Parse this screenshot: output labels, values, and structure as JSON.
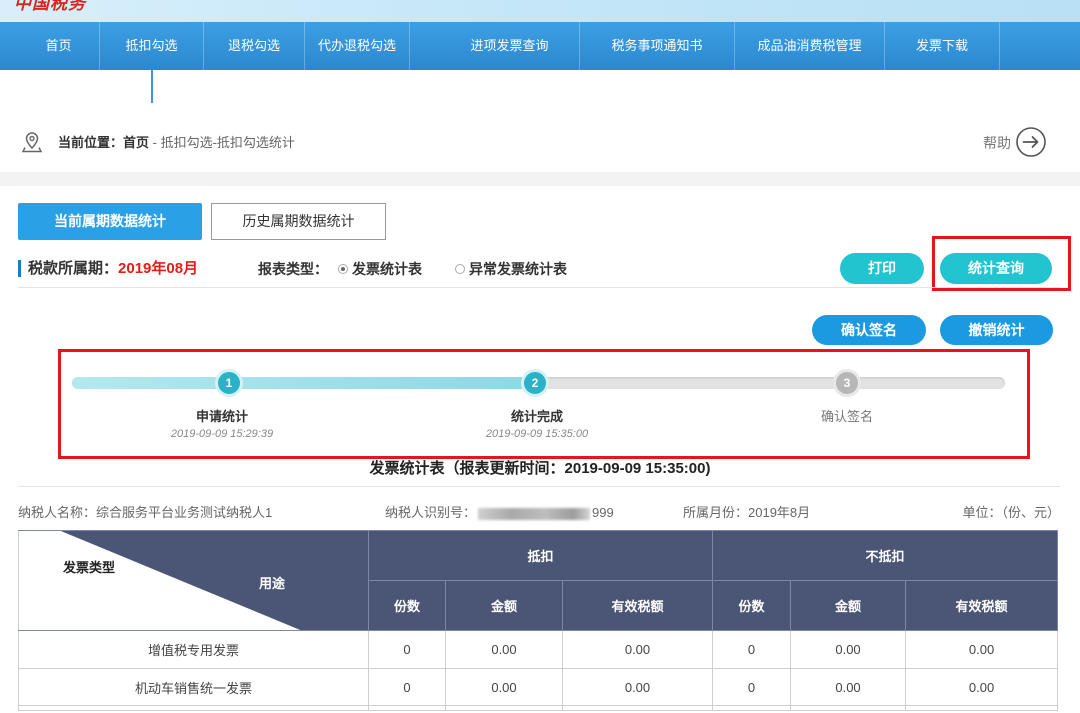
{
  "header": {
    "logo_text": "中国税务"
  },
  "nav": {
    "active_index": 1,
    "items": [
      {
        "label": "首页"
      },
      {
        "label": "抵扣勾选"
      },
      {
        "label": "退税勾选"
      },
      {
        "label": "代办退税勾选"
      },
      {
        "label": "进项发票查询"
      },
      {
        "label": "税务事项通知书"
      },
      {
        "label": "成品油消费税管理"
      },
      {
        "label": "发票下载"
      }
    ]
  },
  "breadcrumb": {
    "prefix": "当前位置：",
    "home": "首页",
    "path": " - 抵扣勾选-抵扣勾选统计",
    "icon": "location-pin-icon"
  },
  "help": {
    "label": "帮助",
    "icon": "arrow-circle-right-icon"
  },
  "tabs": [
    {
      "label": "当前属期数据统计",
      "active": true
    },
    {
      "label": "历史属期数据统计",
      "active": false
    }
  ],
  "period": {
    "label": "税款所属期：",
    "value": "2019年08月"
  },
  "report_type": {
    "label": "报表类型：",
    "options": [
      {
        "label": "发票统计表",
        "checked": true
      },
      {
        "label": "异常发票统计表",
        "checked": false
      }
    ]
  },
  "actions": {
    "print": "打印",
    "query": "统计查询",
    "confirm_sign": "确认签名",
    "revoke": "撤销统计"
  },
  "progress": {
    "completed_steps": 2,
    "total_steps": 3
  },
  "steps": [
    {
      "number": "1",
      "label": "申请统计",
      "time": "2019-09-09 15:29:39",
      "completed": true
    },
    {
      "number": "2",
      "label": "统计完成",
      "time": "2019-09-09 15:35:00",
      "completed": true
    },
    {
      "number": "3",
      "label": "确认签名",
      "completed": false
    }
  ],
  "report": {
    "title": "发票统计表（报表更新时间：2019-09-09 15:35:00)",
    "taxpayer_name_label": "纳税人名称：",
    "taxpayer_name": "综合服务平台业务测试纳税人1",
    "taxpayer_id_label": "纳税人识别号：",
    "taxpayer_id_visible_suffix": "999",
    "month_label": "所属月份：",
    "month": "2019年8月",
    "unit_label": "单位：",
    "unit": "（份、元）"
  },
  "table": {
    "corner_row_label": "发票类型",
    "corner_col_label": "用途",
    "groups": [
      "抵扣",
      "不抵扣"
    ],
    "sub_headers": [
      "份数",
      "金额",
      "有效税额"
    ],
    "rows": [
      {
        "type": "增值税专用发票",
        "deduct": [
          "0",
          "0.00",
          "0.00"
        ],
        "non_deduct": [
          "0",
          "0.00",
          "0.00"
        ]
      },
      {
        "type": "机动车销售统一发票",
        "deduct": [
          "0",
          "0.00",
          "0.00"
        ],
        "non_deduct": [
          "0",
          "0.00",
          "0.00"
        ]
      }
    ]
  },
  "colors": {
    "nav": "#2f8fd4",
    "accent_blue": "#1b9ae2",
    "teal": "#22c4cf",
    "highlight_red": "#e8141b",
    "period_red": "#e0201a",
    "table_header": "#4b5676",
    "step_done": "#2ab3c8",
    "step_pending": "#b7b7b7"
  }
}
